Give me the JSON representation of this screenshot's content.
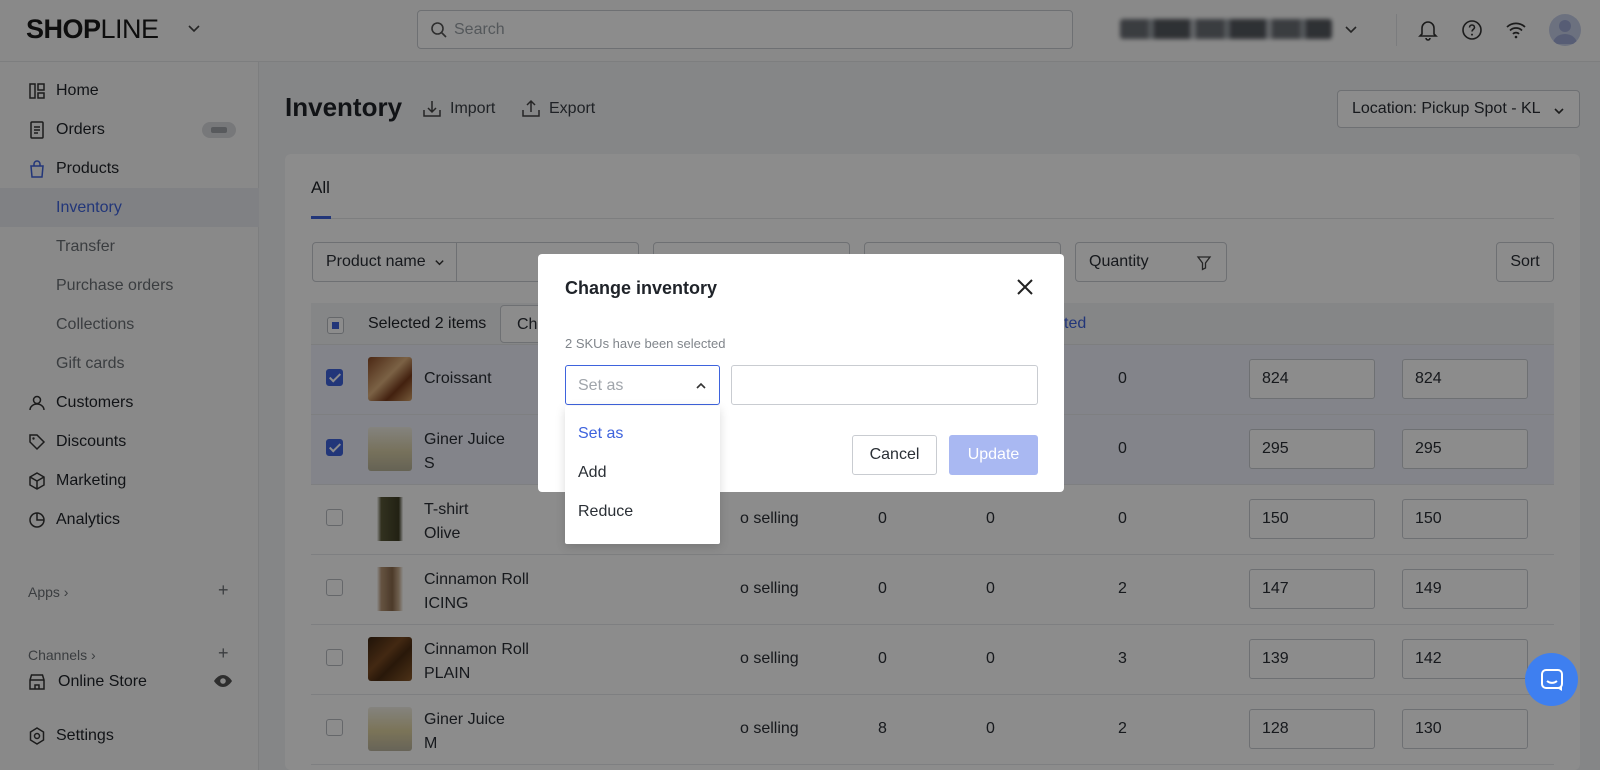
{
  "app": {
    "logo_bold": "SHOP",
    "logo_thin": "LINE"
  },
  "topbar": {
    "search_placeholder": "Search"
  },
  "sidebar": {
    "items": [
      {
        "label": "Home"
      },
      {
        "label": "Orders"
      },
      {
        "label": "Products"
      },
      {
        "label": "Inventory"
      },
      {
        "label": "Transfer"
      },
      {
        "label": "Purchase orders"
      },
      {
        "label": "Collections"
      },
      {
        "label": "Gift cards"
      },
      {
        "label": "Customers"
      },
      {
        "label": "Discounts"
      },
      {
        "label": "Marketing"
      },
      {
        "label": "Analytics"
      }
    ],
    "apps_label": "Apps",
    "channels_label": "Channels",
    "online_store_label": "Online Store",
    "settings_label": "Settings"
  },
  "page": {
    "title": "Inventory",
    "import_label": "Import",
    "export_label": "Export",
    "location_label": "Location: Pickup Spot - KL",
    "tab_all": "All",
    "filter_product_name": "Product name",
    "filter_quantity": "Quantity",
    "sort_label": "Sort"
  },
  "table": {
    "selected_text": "Selected 2 items",
    "bulk_button_label": "Ch",
    "selected_link": "cted",
    "rows": [
      {
        "name": "Croissant",
        "variant": "",
        "stock": "",
        "n1": "",
        "n2": "",
        "n3": "0",
        "v1": "824",
        "v2": "824",
        "checked": true
      },
      {
        "name": "Giner Juice",
        "variant": "S",
        "stock": "",
        "n1": "",
        "n2": "",
        "n3": "0",
        "v1": "295",
        "v2": "295",
        "checked": true
      },
      {
        "name": "T-shirt",
        "variant": "Olive",
        "stock": "o selling",
        "n1": "0",
        "n2": "0",
        "n3": "0",
        "v1": "150",
        "v2": "150",
        "checked": false
      },
      {
        "name": "Cinnamon Roll",
        "variant": "ICING",
        "stock": "o selling",
        "n1": "0",
        "n2": "0",
        "n3": "2",
        "v1": "147",
        "v2": "149",
        "checked": false
      },
      {
        "name": "Cinnamon Roll",
        "variant": "PLAIN",
        "stock": "o selling",
        "n1": "0",
        "n2": "0",
        "n3": "3",
        "v1": "139",
        "v2": "142",
        "checked": false
      },
      {
        "name": "Giner Juice",
        "variant": "M",
        "stock": "o selling",
        "n1": "8",
        "n2": "0",
        "n3": "2",
        "v1": "128",
        "v2": "130",
        "checked": false
      }
    ]
  },
  "modal": {
    "title": "Change inventory",
    "subtitle": "2 SKUs have been selected",
    "mode_value": "Set as",
    "cancel_label": "Cancel",
    "update_label": "Update",
    "options": [
      "Set as",
      "Add",
      "Reduce"
    ]
  },
  "colors": {
    "accent": "#3e63dd",
    "update_disabled": "#a9b8f2",
    "chat": "#3e7ff0"
  },
  "icons": [
    "chevron-down-icon",
    "search-icon",
    "bell-icon",
    "help-icon",
    "wifi-icon",
    "avatar",
    "home-icon",
    "orders-icon",
    "products-icon",
    "customers-icon",
    "discounts-icon",
    "marketing-icon",
    "analytics-icon",
    "store-icon",
    "eye-icon",
    "settings-icon",
    "import-icon",
    "export-icon",
    "filter-icon",
    "close-icon",
    "chevron-up-icon",
    "chat-icon"
  ]
}
